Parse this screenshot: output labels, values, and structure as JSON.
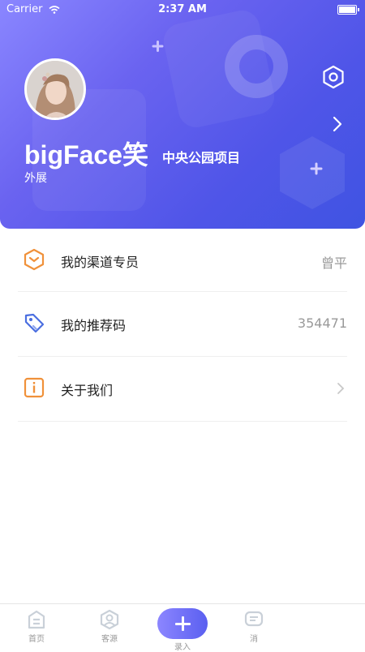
{
  "status_bar": {
    "carrier": "Carrier",
    "time": "2:37 AM"
  },
  "profile": {
    "name": "bigFace笑",
    "project": "中央公园项目",
    "role": "外展"
  },
  "menu": [
    {
      "label": "我的渠道专员",
      "value": "曾平",
      "icon": "channel-hex-icon"
    },
    {
      "label": "我的推荐码",
      "value": "354471",
      "icon": "tag-icon"
    },
    {
      "label": "关于我们",
      "value": "",
      "icon": "info-icon"
    }
  ],
  "tabbar": {
    "home": "首页",
    "clients": "客源",
    "add": "录入",
    "messages": "消"
  },
  "colors": {
    "header_start": "#8a86ff",
    "header_end": "#3f54e2",
    "accent_orange": "#f0913a",
    "accent_blue": "#4a6ee0"
  }
}
